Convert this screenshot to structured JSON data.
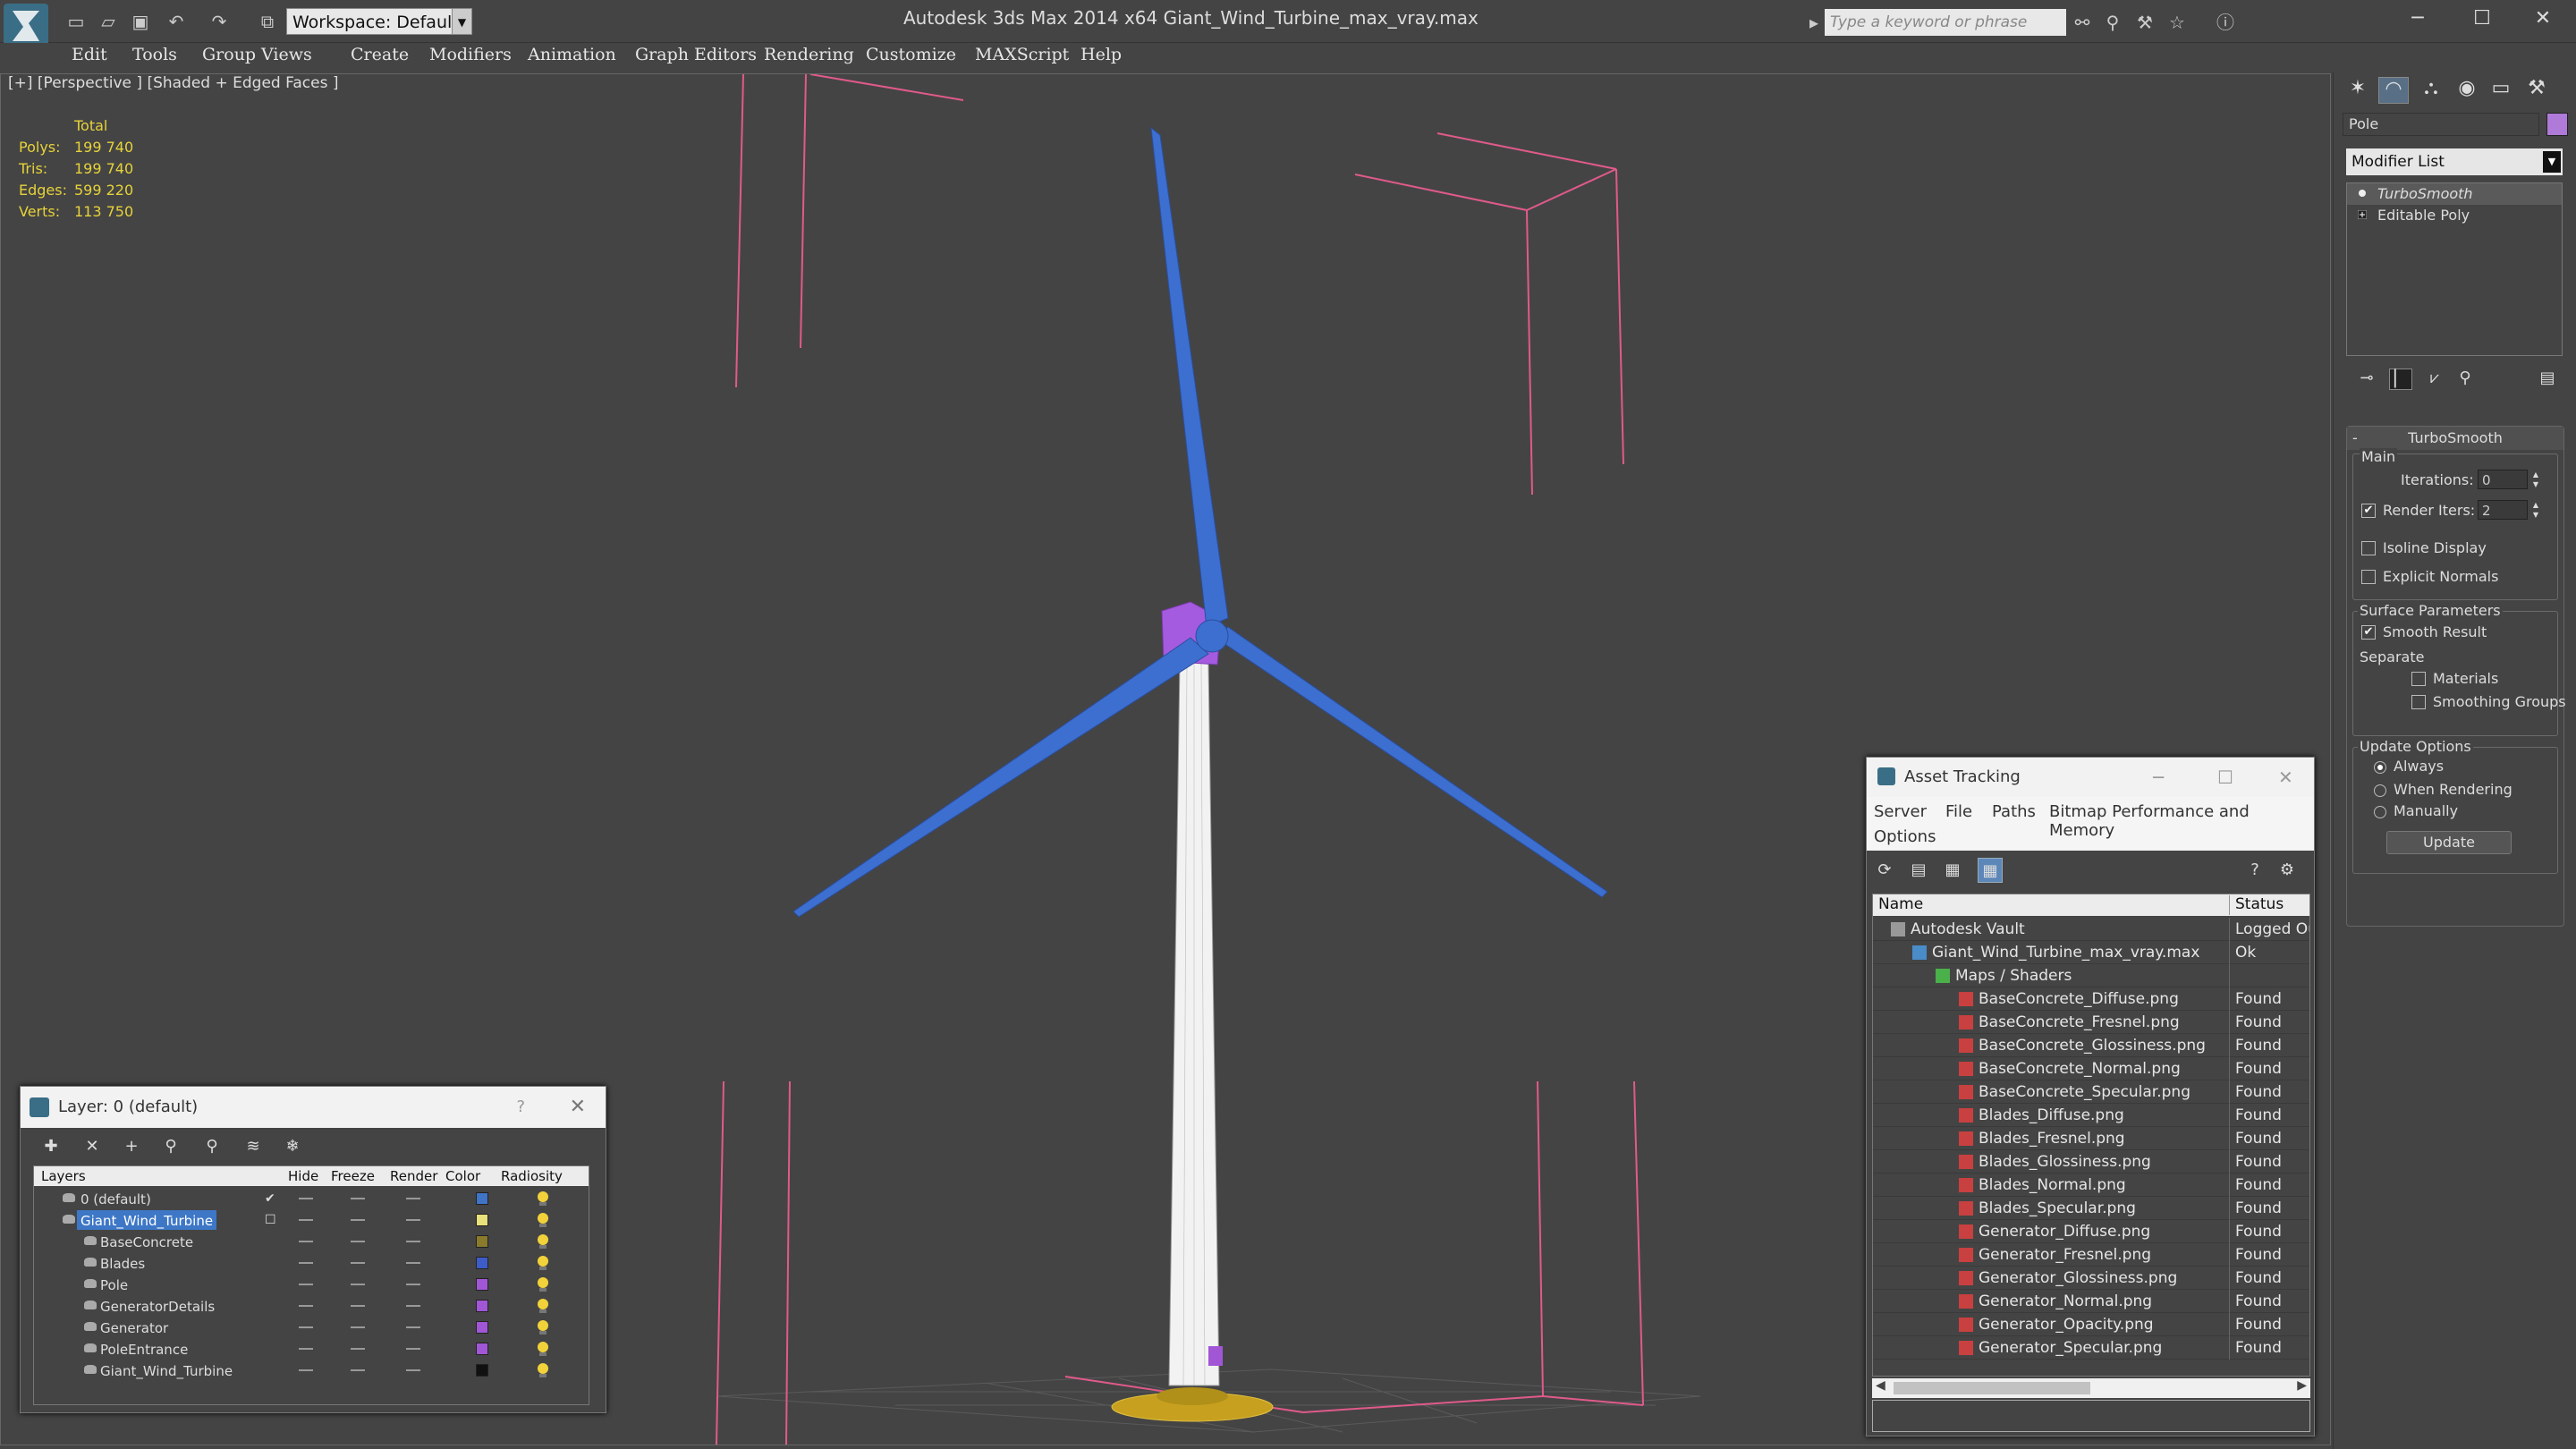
{
  "app": {
    "window_title": "Autodesk 3ds Max  2014 x64        Giant_Wind_Turbine_max_vray.max",
    "workspace": "Workspace: Default",
    "search_placeholder": "Type a keyword or phrase"
  },
  "menu": [
    "Edit",
    "Tools",
    "Group",
    "Views",
    "Create",
    "Modifiers",
    "Animation",
    "Graph Editors",
    "Rendering",
    "Customize",
    "MAXScript",
    "Help"
  ],
  "viewport": {
    "label": "[+] [Perspective ] [Shaded + Edged Faces ]",
    "stats": {
      "header": "Total",
      "rows": [
        {
          "k": "Polys:",
          "v": "199 740"
        },
        {
          "k": "Tris:",
          "v": "199 740"
        },
        {
          "k": "Edges:",
          "v": "599 220"
        },
        {
          "k": "Verts:",
          "v": "113 750"
        }
      ]
    }
  },
  "command_panel": {
    "object_name": "Pole",
    "object_color": "#b07ad8",
    "modifier_list": "Modifier List",
    "stack": [
      "TurboSmooth",
      "Editable Poly"
    ],
    "turbosmooth": {
      "title": "TurboSmooth",
      "main": "Main",
      "iterations_label": "Iterations:",
      "iterations": "0",
      "render_iters_label": "Render Iters:",
      "render_iters": "2",
      "render_iters_checked": true,
      "isoline": "Isoline Display",
      "explicit_normals": "Explicit Normals",
      "surface_params": "Surface Parameters",
      "smooth_result": "Smooth Result",
      "separate": "Separate",
      "materials": "Materials",
      "smoothing_groups": "Smoothing Groups",
      "update_options": "Update Options",
      "always": "Always",
      "when_rendering": "When Rendering",
      "manually": "Manually",
      "update_button": "Update"
    }
  },
  "layer_window": {
    "title": "Layer: 0 (default)",
    "help": "?",
    "columns": [
      "Layers",
      "Hide",
      "Freeze",
      "Render",
      "Color",
      "Radiosity"
    ],
    "rows": [
      {
        "name": "0 (default)",
        "color": "#3f74c6",
        "level": 0,
        "selected": false,
        "checked": true
      },
      {
        "name": "Giant_Wind_Turbine",
        "color": "#e8e07a",
        "level": 0,
        "selected": true,
        "checked": false
      },
      {
        "name": "BaseConcrete",
        "color": "#8a7a2c",
        "level": 1
      },
      {
        "name": "Blades",
        "color": "#3d5cc8",
        "level": 1
      },
      {
        "name": "Pole",
        "color": "#a156d6",
        "level": 1
      },
      {
        "name": "GeneratorDetails",
        "color": "#a156d6",
        "level": 1
      },
      {
        "name": "Generator",
        "color": "#a156d6",
        "level": 1
      },
      {
        "name": "PoleEntrance",
        "color": "#a156d6",
        "level": 1
      },
      {
        "name": "Giant_Wind_Turbine",
        "color": "#111111",
        "level": 1
      }
    ]
  },
  "asset_window": {
    "title": "Asset Tracking",
    "menu": [
      "Server",
      "File",
      "Paths",
      "Bitmap Performance and Memory",
      "Options"
    ],
    "columns": [
      "Name",
      "Status"
    ],
    "rows": [
      {
        "name": "Autodesk Vault",
        "status": "Logged Ou",
        "indent": 0,
        "icon": "vault"
      },
      {
        "name": "Giant_Wind_Turbine_max_vray.max",
        "status": "Ok",
        "indent": 1,
        "icon": "max"
      },
      {
        "name": "Maps / Shaders",
        "status": "",
        "indent": 2,
        "icon": "folder"
      },
      {
        "name": "BaseConcrete_Diffuse.png",
        "status": "Found",
        "indent": 3,
        "icon": "png"
      },
      {
        "name": "BaseConcrete_Fresnel.png",
        "status": "Found",
        "indent": 3,
        "icon": "png"
      },
      {
        "name": "BaseConcrete_Glossiness.png",
        "status": "Found",
        "indent": 3,
        "icon": "png"
      },
      {
        "name": "BaseConcrete_Normal.png",
        "status": "Found",
        "indent": 3,
        "icon": "png"
      },
      {
        "name": "BaseConcrete_Specular.png",
        "status": "Found",
        "indent": 3,
        "icon": "png"
      },
      {
        "name": "Blades_Diffuse.png",
        "status": "Found",
        "indent": 3,
        "icon": "png"
      },
      {
        "name": "Blades_Fresnel.png",
        "status": "Found",
        "indent": 3,
        "icon": "png"
      },
      {
        "name": "Blades_Glossiness.png",
        "status": "Found",
        "indent": 3,
        "icon": "png"
      },
      {
        "name": "Blades_Normal.png",
        "status": "Found",
        "indent": 3,
        "icon": "png"
      },
      {
        "name": "Blades_Specular.png",
        "status": "Found",
        "indent": 3,
        "icon": "png"
      },
      {
        "name": "Generator_Diffuse.png",
        "status": "Found",
        "indent": 3,
        "icon": "png"
      },
      {
        "name": "Generator_Fresnel.png",
        "status": "Found",
        "indent": 3,
        "icon": "png"
      },
      {
        "name": "Generator_Glossiness.png",
        "status": "Found",
        "indent": 3,
        "icon": "png"
      },
      {
        "name": "Generator_Normal.png",
        "status": "Found",
        "indent": 3,
        "icon": "png"
      },
      {
        "name": "Generator_Opacity.png",
        "status": "Found",
        "indent": 3,
        "icon": "png"
      },
      {
        "name": "Generator_Specular.png",
        "status": "Found",
        "indent": 3,
        "icon": "png"
      }
    ]
  }
}
